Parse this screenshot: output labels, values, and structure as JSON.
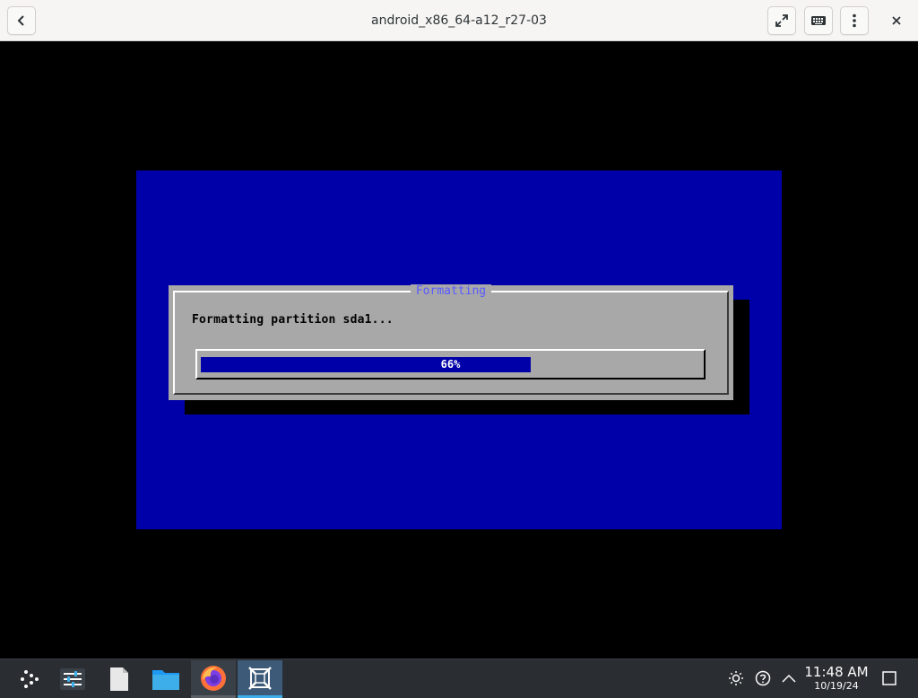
{
  "window": {
    "title": "android_x86_64-a12_r27-03",
    "buttons": {
      "back": "chevron-left-icon",
      "fullscreen": "fullscreen-icon",
      "keyboard": "keyboard-icon",
      "menu": "menu-dots-icon",
      "close": "close-icon"
    }
  },
  "installer": {
    "background_color": "#0000a8",
    "dialog": {
      "title": "Formatting",
      "message": "Formatting partition sda1...",
      "progress": {
        "percent": 66,
        "label": "66%"
      }
    }
  },
  "taskbar": {
    "apps": [
      {
        "name": "launcher",
        "icon": "launcher-icon",
        "state": "idle"
      },
      {
        "name": "settings",
        "icon": "sliders-icon",
        "state": "idle"
      },
      {
        "name": "files",
        "icon": "document-icon",
        "state": "idle"
      },
      {
        "name": "folder",
        "icon": "folder-icon",
        "state": "idle"
      },
      {
        "name": "firefox",
        "icon": "firefox-icon",
        "state": "open"
      },
      {
        "name": "virtual-machine",
        "icon": "vm-icon",
        "state": "active"
      }
    ],
    "tray": [
      "brightness-icon",
      "help-icon",
      "chevron-up-icon"
    ],
    "clock": {
      "time": "11:48 AM",
      "date": "10/19/24"
    }
  }
}
